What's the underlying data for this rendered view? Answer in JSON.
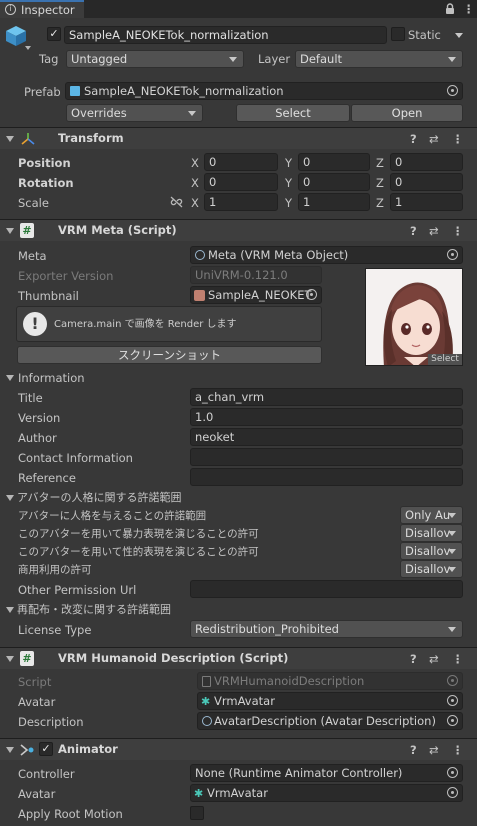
{
  "tab": {
    "title": "Inspector",
    "lock": "lock-icon",
    "menu": "⋮"
  },
  "object": {
    "name": "SampleA_NEOKETok_normalization",
    "static_label": "Static",
    "tag_label": "Tag",
    "tag_value": "Untagged",
    "layer_label": "Layer",
    "layer_value": "Default",
    "prefab_label": "Prefab",
    "prefab_value": "SampleA_NEOKETok_normalization",
    "overrides": "Overrides",
    "select": "Select",
    "open": "Open"
  },
  "transform": {
    "title": "Transform",
    "position_label": "Position",
    "rotation_label": "Rotation",
    "scale_label": "Scale",
    "x": "X",
    "y": "Y",
    "z": "Z",
    "position": [
      "0",
      "0",
      "0"
    ],
    "rotation": [
      "0",
      "0",
      "0"
    ],
    "scale": [
      "1",
      "1",
      "1"
    ]
  },
  "vrm_meta": {
    "title": "VRM Meta (Script)",
    "meta_label": "Meta",
    "meta_value": "Meta (VRM Meta Object)",
    "exporter_label": "Exporter Version",
    "exporter_value": "UniVRM-0.121.0",
    "thumbnail_label": "Thumbnail",
    "thumbnail_value": "SampleA_NEOKET",
    "thumb_select": "Select",
    "info_message": "Camera.main で画像を Render します",
    "screenshot_button": "スクリーンショット",
    "information_label": "Information",
    "title_label": "Title",
    "title_value": "a_chan_vrm",
    "version_label": "Version",
    "version_value": "1.0",
    "author_label": "Author",
    "author_value": "neoket",
    "contact_label": "Contact Information",
    "contact_value": "",
    "reference_label": "Reference",
    "reference_value": "",
    "persona_section": "アバターの人格に関する許諾範囲",
    "perm1_label": "アバターに人格を与えることの許諾範囲",
    "perm1_value": "Only Au",
    "perm2_label": "このアバターを用いて暴力表現を演じることの許可",
    "perm2_value": "Disallov",
    "perm3_label": "このアバターを用いて性的表現を演じることの許可",
    "perm3_value": "Disallov",
    "perm4_label": "商用利用の許可",
    "perm4_value": "Disallov",
    "other_perm_label": "Other Permission Url",
    "other_perm_value": "",
    "redistribution_section": "再配布・改変に関する許諾範囲",
    "license_label": "License Type",
    "license_value": "Redistribution_Prohibited"
  },
  "humanoid": {
    "title": "VRM Humanoid Description (Script)",
    "script_label": "Script",
    "script_value": "VRMHumanoidDescription",
    "avatar_label": "Avatar",
    "avatar_value": "VrmAvatar",
    "description_label": "Description",
    "description_value": "AvatarDescription (Avatar Description)"
  },
  "animator": {
    "title": "Animator",
    "controller_label": "Controller",
    "controller_value": "None (Runtime Animator Controller)",
    "avatar_label": "Avatar",
    "avatar_value": "VrmAvatar",
    "apply_root_label": "Apply Root Motion"
  },
  "header_icons": {
    "help": "?",
    "preset": "⇄",
    "menu": "⋮"
  }
}
